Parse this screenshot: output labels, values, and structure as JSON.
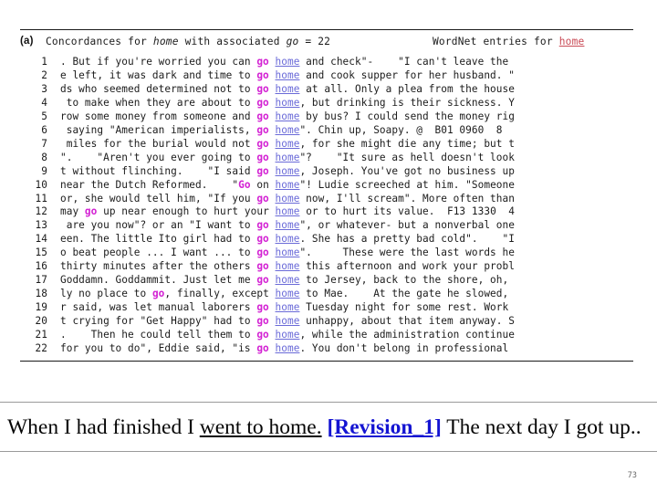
{
  "figure": {
    "panel_label": "(a)",
    "header_left_prefix": "Concordances for ",
    "header_left_word1": "home",
    "header_left_mid": " with associated ",
    "header_left_word2": "go",
    "header_left_suffix": " = 22",
    "header_right_prefix": "WordNet entries for ",
    "header_right_word": "home",
    "keyword_go": "go",
    "keyword_go_cap": "Go",
    "keyword_home": "home",
    "colors": {
      "go": "#d321d3",
      "home": "#6a6ad8",
      "wordnet_home": "#c94a55",
      "revision_link": "#1414d2",
      "text": "#1b1b1b"
    }
  },
  "concordance": {
    "lines": [
      {
        "n": "1",
        "left": ". But if you're worried you can ",
        "kw1": "go",
        "mid": " ",
        "kw2": "home",
        "right": " and check\"-    \"I can't leave the"
      },
      {
        "n": "2",
        "left": "e left, it was dark and time to ",
        "kw1": "go",
        "mid": " ",
        "kw2": "home",
        "right": " and cook supper for her husband. \""
      },
      {
        "n": "3",
        "left": "ds who seemed determined not to ",
        "kw1": "go",
        "mid": " ",
        "kw2": "home",
        "right": " at all. Only a plea from the house"
      },
      {
        "n": "4",
        "left": " to make when they are about to ",
        "kw1": "go",
        "mid": " ",
        "kw2": "home",
        "right": ", but drinking is their sickness. Y"
      },
      {
        "n": "5",
        "left": "row some money from someone and ",
        "kw1": "go",
        "mid": " ",
        "kw2": "home",
        "right": " by bus? I could send the money rig"
      },
      {
        "n": "6",
        "left": " saying \"American imperialists, ",
        "kw1": "go",
        "mid": " ",
        "kw2": "home",
        "right": "\". Chin up, Soapy. @  B01 0960  8"
      },
      {
        "n": "7",
        "left": " miles for the burial would not ",
        "kw1": "go",
        "mid": " ",
        "kw2": "home",
        "right": ", for she might die any time; but t"
      },
      {
        "n": "8",
        "left": "\".    \"Aren't you ever going to ",
        "kw1": "go",
        "mid": " ",
        "kw2": "home",
        "right": "\"?    \"It sure as hell doesn't look"
      },
      {
        "n": "9",
        "left": "t without flinching.    \"I said ",
        "kw1": "go",
        "mid": " ",
        "kw2": "home",
        "right": ", Joseph. You've got no business up"
      },
      {
        "n": "10",
        "left": "near the Dutch Reformed.    \"",
        "kw1": "Go",
        "mid": " on ",
        "kw2": "home",
        "right": "\"! Ludie screeched at him. \"Someone"
      },
      {
        "n": "11",
        "left": "or, she would tell him, \"If you ",
        "kw1": "go",
        "mid": " ",
        "kw2": "home",
        "right": " now, I'll scream\". More often than"
      },
      {
        "n": "12",
        "left": "may ",
        "kw1": "go",
        "mid": " up near enough to hurt your ",
        "kw2": "home",
        "right": " or to hurt its value.  F13 1330  4"
      },
      {
        "n": "13",
        "left": " are you now\"? or an \"I want to ",
        "kw1": "go",
        "mid": " ",
        "kw2": "home",
        "right": "\", or whatever- but a nonverbal one"
      },
      {
        "n": "14",
        "left": "een. The little Ito girl had to ",
        "kw1": "go",
        "mid": " ",
        "kw2": "home",
        "right": ". She has a pretty bad cold\".    \"I"
      },
      {
        "n": "15",
        "left": "o beat people ... I want ... to ",
        "kw1": "go",
        "mid": " ",
        "kw2": "home",
        "right": "\".     These were the last words he"
      },
      {
        "n": "16",
        "left": "thirty minutes after the others ",
        "kw1": "go",
        "mid": " ",
        "kw2": "home",
        "right": " this afternoon and work your probl"
      },
      {
        "n": "17",
        "left": "Goddamn. Goddammit. Just let me ",
        "kw1": "go",
        "mid": " ",
        "kw2": "home",
        "right": " to Jersey, back to the shore, oh,"
      },
      {
        "n": "18",
        "left": "ly no place to ",
        "kw1": "go",
        "mid": ", finally, except ",
        "kw2": "home",
        "right": " to Mae.    At the gate he slowed,"
      },
      {
        "n": "19",
        "left": "r said, was let manual laborers ",
        "kw1": "go",
        "mid": " ",
        "kw2": "home",
        "right": " Tuesday night for some rest. Work"
      },
      {
        "n": "20",
        "left": "t crying for \"Get Happy\" had to ",
        "kw1": "go",
        "mid": " ",
        "kw2": "home",
        "right": " unhappy, about that item anyway. S"
      },
      {
        "n": "21",
        "left": ".    Then he could tell them to ",
        "kw1": "go",
        "mid": " ",
        "kw2": "home",
        "right": ", while the administration continue"
      },
      {
        "n": "22",
        "left": "for you to do\", Eddie said, \"is ",
        "kw1": "go",
        "mid": " ",
        "kw2": "home",
        "right": ". You don't belong in professional"
      }
    ]
  },
  "sentence": {
    "part1": "When I had finished I ",
    "underlined": "went to home.",
    "space1": " ",
    "revision_label": "[Revision_1]",
    "part2": " The next day I got up.."
  },
  "page_number": "73"
}
